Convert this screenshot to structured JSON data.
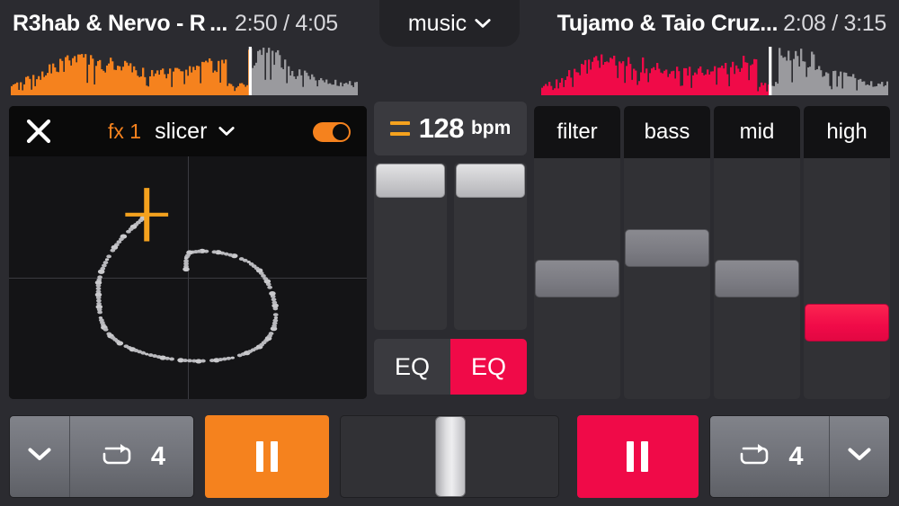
{
  "colors": {
    "deck_a_accent": "#f5821e",
    "deck_b_accent": "#f00a48",
    "background": "#2b2b30",
    "panel": "#313135",
    "panel_dark": "#0d0d0d",
    "text": "#ffffff"
  },
  "center_tab": {
    "label": "music",
    "chevron_icon": "chevron-down-icon"
  },
  "decks": {
    "a": {
      "track_title": "R3hab & Nervo - R ...",
      "elapsed": "2:50",
      "separator": "/",
      "duration": "4:05",
      "time_display": "2:50 / 4:05",
      "waveform_progress_pct": 69,
      "accent": "#f5821e",
      "transport": {
        "chevron_icon": "chevron-down-icon",
        "loop_icon": "loop-icon",
        "loop_beats": "4",
        "play_state_icon": "pause-icon"
      }
    },
    "b": {
      "track_title": "Tujamo & Taio Cruz...",
      "elapsed": "2:08",
      "separator": "/",
      "duration": "3:15",
      "time_display": "2:08 / 3:15",
      "waveform_progress_pct": 66,
      "accent": "#f00a48",
      "transport": {
        "chevron_icon": "chevron-down-icon",
        "loop_icon": "loop-icon",
        "loop_beats": "4",
        "play_state_icon": "pause-icon"
      }
    }
  },
  "fx_panel": {
    "close_icon": "close-x-icon",
    "slot_label": "fx 1",
    "effect_name": "slicer",
    "chevron_icon": "chevron-down-icon",
    "toggle_state": "on",
    "pad": {
      "cursor_x_pct": 38.5,
      "cursor_y_pct": 24.0,
      "trail_points": [
        [
          37.5,
          25.5
        ],
        [
          34.8,
          29.0
        ],
        [
          32.0,
          33.0
        ],
        [
          29.5,
          37.5
        ],
        [
          27.4,
          42.5
        ],
        [
          25.8,
          47.5
        ],
        [
          25.0,
          52.0
        ],
        [
          25.0,
          57.0
        ],
        [
          25.2,
          62.0
        ],
        [
          25.6,
          66.5
        ],
        [
          26.6,
          70.5
        ],
        [
          28.4,
          74.0
        ],
        [
          31.0,
          77.0
        ],
        [
          34.5,
          79.5
        ],
        [
          38.5,
          81.5
        ],
        [
          43.0,
          83.0
        ],
        [
          48.0,
          84.0
        ],
        [
          53.0,
          84.4
        ],
        [
          58.0,
          84.0
        ],
        [
          62.5,
          83.0
        ],
        [
          66.5,
          81.0
        ],
        [
          70.0,
          78.5
        ],
        [
          72.5,
          75.0
        ],
        [
          74.0,
          71.0
        ],
        [
          74.6,
          66.5
        ],
        [
          74.4,
          61.5
        ],
        [
          73.6,
          56.5
        ],
        [
          72.2,
          51.5
        ],
        [
          70.0,
          47.0
        ],
        [
          67.0,
          43.5
        ],
        [
          63.0,
          41.0
        ],
        [
          58.5,
          39.5
        ],
        [
          54.0,
          39.0
        ],
        [
          50.5,
          39.6
        ],
        [
          49.5,
          42.0
        ],
        [
          49.5,
          46.5
        ]
      ]
    }
  },
  "bpm": {
    "sync_icon": "sync-equals-icon",
    "value": "128",
    "unit": "bpm"
  },
  "tempo_faders": [
    {
      "name": "tempo-a",
      "value_pct": 100
    },
    {
      "name": "tempo-b",
      "value_pct": 100
    }
  ],
  "eq_buttons": [
    {
      "label": "EQ",
      "state": "off"
    },
    {
      "label": "EQ",
      "state": "on"
    }
  ],
  "mixer": {
    "channels": [
      {
        "label": "filter",
        "value_pct": 50,
        "accent": false
      },
      {
        "label": "bass",
        "value_pct": 65,
        "accent": false
      },
      {
        "label": "mid",
        "value_pct": 50,
        "accent": false
      },
      {
        "label": "high",
        "value_pct": 28,
        "accent": true
      }
    ]
  },
  "crossfader": {
    "name": "crossfader",
    "value_pct": 50
  }
}
